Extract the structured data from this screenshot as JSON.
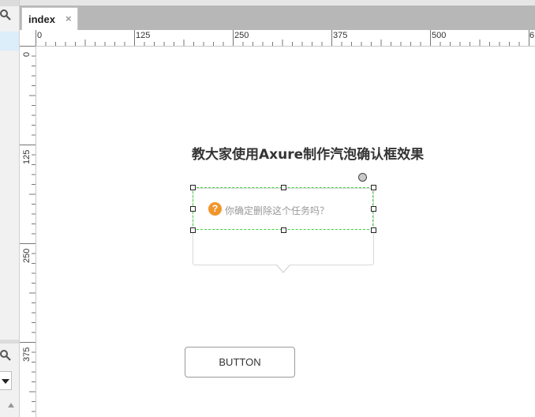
{
  "tab": {
    "label": "index",
    "close": "×"
  },
  "ruler": {
    "h_labels": [
      "0",
      "125",
      "250",
      "375",
      "500",
      "6"
    ],
    "v_labels": [
      "0",
      "125",
      "250",
      "375"
    ]
  },
  "canvas": {
    "title": "教大家使用Axure制作汽泡确认框效果",
    "confirm_text": "你确定删除这个任务吗？",
    "question_symbol": "?",
    "button_label": "BUTTON"
  },
  "colors": {
    "accent_question": "#f0962c",
    "selection": "#3ecf3e",
    "tabbar": "#b7b7b7"
  },
  "icons": [
    "search-icon",
    "close-icon",
    "question-icon",
    "chevron-down-icon"
  ]
}
